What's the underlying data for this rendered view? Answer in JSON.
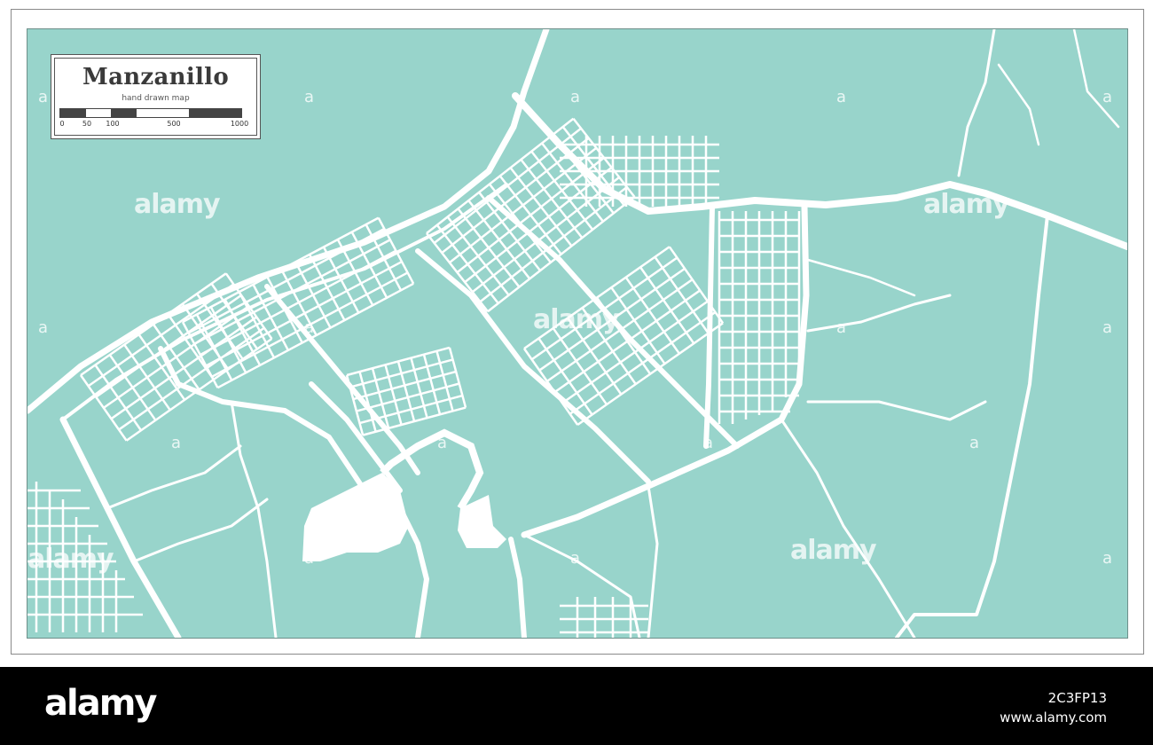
{
  "map": {
    "title": "Manzanillo",
    "subtitle": "hand drawn map",
    "scale_labels": [
      "0",
      "50",
      "100",
      "500",
      "1000"
    ],
    "colors": {
      "water_land": "#98d4cb",
      "roads": "#ffffff",
      "frame": "#8a8a8a"
    }
  },
  "watermarks": {
    "text": "alamy",
    "glyph": "a"
  },
  "footer": {
    "brand": "alamy",
    "image_id": "2C3FP13",
    "site": "www.alamy.com"
  }
}
